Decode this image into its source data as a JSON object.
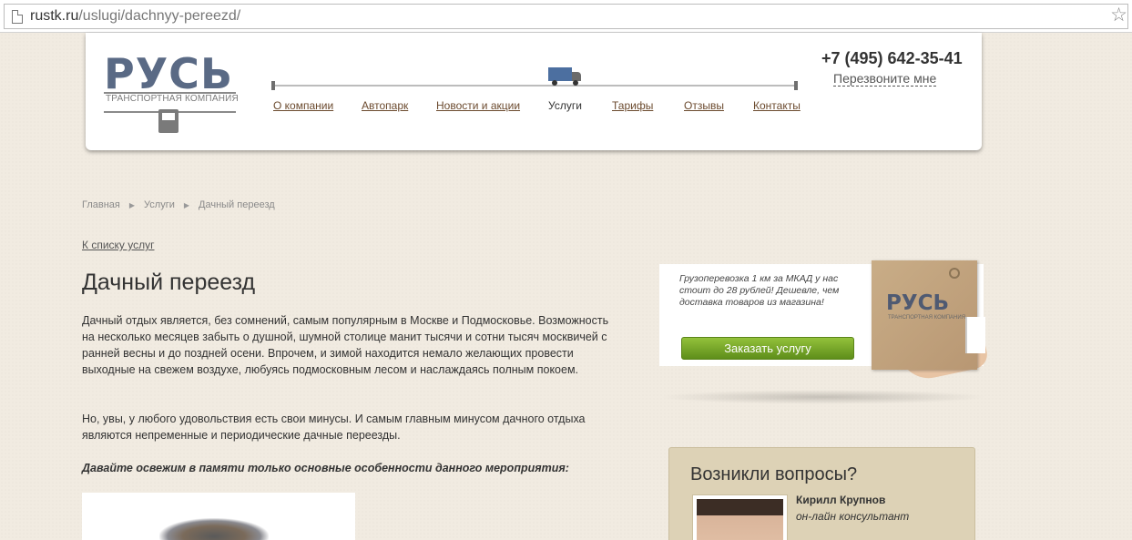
{
  "browser": {
    "url_host": "rustk.ru",
    "url_path": "/uslugi/dachnyy-pereezd/"
  },
  "logo": {
    "word": "РУСЬ",
    "subtitle": "ТРАНСПОРТНАЯ КОМПАНИЯ"
  },
  "nav": {
    "items": [
      {
        "label": "О компании"
      },
      {
        "label": "Автопарк"
      },
      {
        "label": "Новости и акции"
      },
      {
        "label": "Услуги"
      },
      {
        "label": "Тарифы"
      },
      {
        "label": "Отзывы"
      },
      {
        "label": "Контакты"
      }
    ],
    "active": "Услуги"
  },
  "contact": {
    "phone": "+7 (495) 642-35-41",
    "callback_label": "Перезвоните мне"
  },
  "breadcrumb": {
    "items": [
      "Главная",
      "Услуги",
      "Дачный переезд"
    ]
  },
  "back_link": "К списку услуг",
  "page_title": "Дачный переезд",
  "content": {
    "p1": "Дачный отдых является, без сомнений, самым популярным в Москве и Подмосковье. Возможность на несколько месяцев забыть о душной, шумной столице манит тысячи и сотни тысяч москвичей с ранней весны и до поздней осени. Впрочем, и зимой находится немало желающих провести выходные на свежем воздухе, любуясь подмосковным лесом и наслаждаясь полным покоем.",
    "p2": "Но, увы, у любого удовольствия есть свои минусы. И самым главным минусом дачного отдыха являются непременные и периодические дачные переезды.",
    "p3": "Давайте освежим в памяти только основные особенности данного мероприятия:"
  },
  "promo": {
    "text": "Грузоперевозка 1 км за МКАД у нас стоит до 28 рублей! Дешевле, чем доставка товаров из магазина!",
    "button_label": "Заказать услугу",
    "box_word": "РУСЬ",
    "box_subtitle": "ТРАНСПОРТНАЯ КОМПАНИЯ"
  },
  "questions": {
    "title": "Возникли вопросы?",
    "consultant_name": "Кирилл Крупнов",
    "consultant_role": "он-лайн консультант"
  },
  "colors": {
    "background": "#f1ebe1",
    "link": "#6b4a2e",
    "logo_blue": "#5a6a85",
    "button_green": "#7aa82b",
    "questions_bg": "#ddd2b6"
  }
}
